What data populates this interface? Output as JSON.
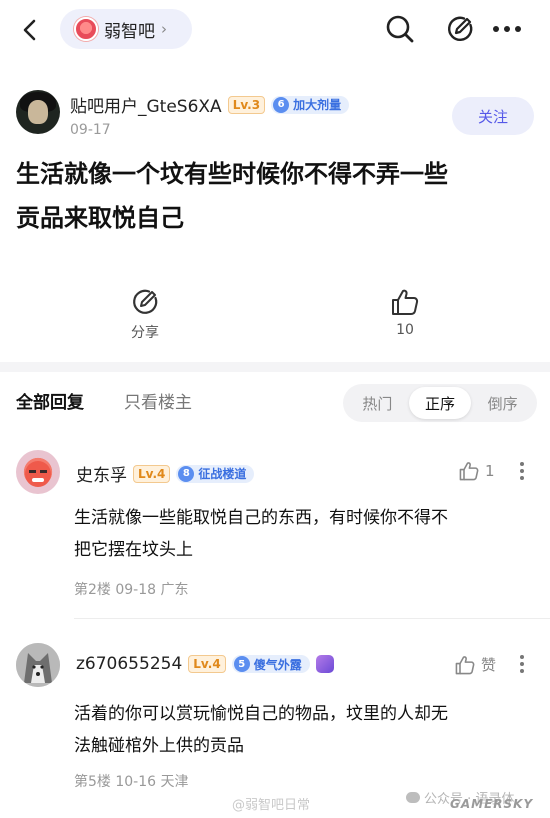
{
  "topbar": {
    "forum_name": "弱智吧",
    "forum_arrow": "›",
    "icons": [
      "back-arrow-icon",
      "search-icon",
      "compose-icon",
      "more-dots-icon"
    ]
  },
  "post": {
    "author": "贴吧用户_GteS6XA",
    "level": "Lv.3",
    "title_badge_num": "6",
    "title_badge_text": "加大剂量",
    "date": "09-17",
    "follow_label": "关注",
    "title_line1": "生活就像一个坟有些时候你不得不弄一些",
    "title_line2": "贡品来取悦自己",
    "share_label": "分享",
    "like_count": "10"
  },
  "replies_header": {
    "tab_all": "全部回复",
    "tab_owner": "只看楼主",
    "sort_options": [
      "热门",
      "正序",
      "倒序"
    ],
    "sort_active": "正序"
  },
  "comments": [
    {
      "name": "史东孚",
      "level": "Lv.4",
      "badge_num": "8",
      "badge_text": "征战楼道",
      "like": "1",
      "text_line1": "生活就像一些能取悦自己的东西，有时候你不得不",
      "text_line2": "把它摆在坟头上",
      "meta": "第2楼  09-18  广东"
    },
    {
      "name": "z670655254",
      "level": "Lv.4",
      "badge_num": "5",
      "badge_text": "傻气外露",
      "like": "赞",
      "text_line1": "活着的你可以赏玩愉悦自己的物品，坟里的人却无",
      "text_line2": "法触碰棺外上供的贡品",
      "meta": "第5楼  10-16  天津"
    }
  ],
  "watermarks": {
    "weibo": "@弱智吧日常",
    "wechat": "公众号 · 语录体",
    "site": "GAMERSKY"
  },
  "colors": {
    "accent": "#5558e8",
    "level_orange": "#e0891b",
    "badge_blue": "#3a6fe0"
  }
}
